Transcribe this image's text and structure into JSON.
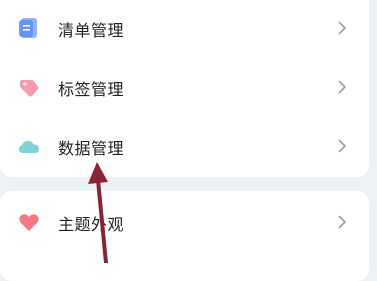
{
  "settings_top": {
    "items": [
      {
        "label": "清单管理",
        "icon": "list-icon"
      },
      {
        "label": "标签管理",
        "icon": "tag-icon"
      },
      {
        "label": "数据管理",
        "icon": "cloud-icon"
      }
    ]
  },
  "settings_bottom": {
    "items": [
      {
        "label": "主题外观",
        "icon": "heart-icon"
      }
    ]
  },
  "colors": {
    "background": "#eef1f6",
    "card": "#ffffff",
    "arrow": "#8b2238",
    "chevron": "#9aa0a6"
  }
}
